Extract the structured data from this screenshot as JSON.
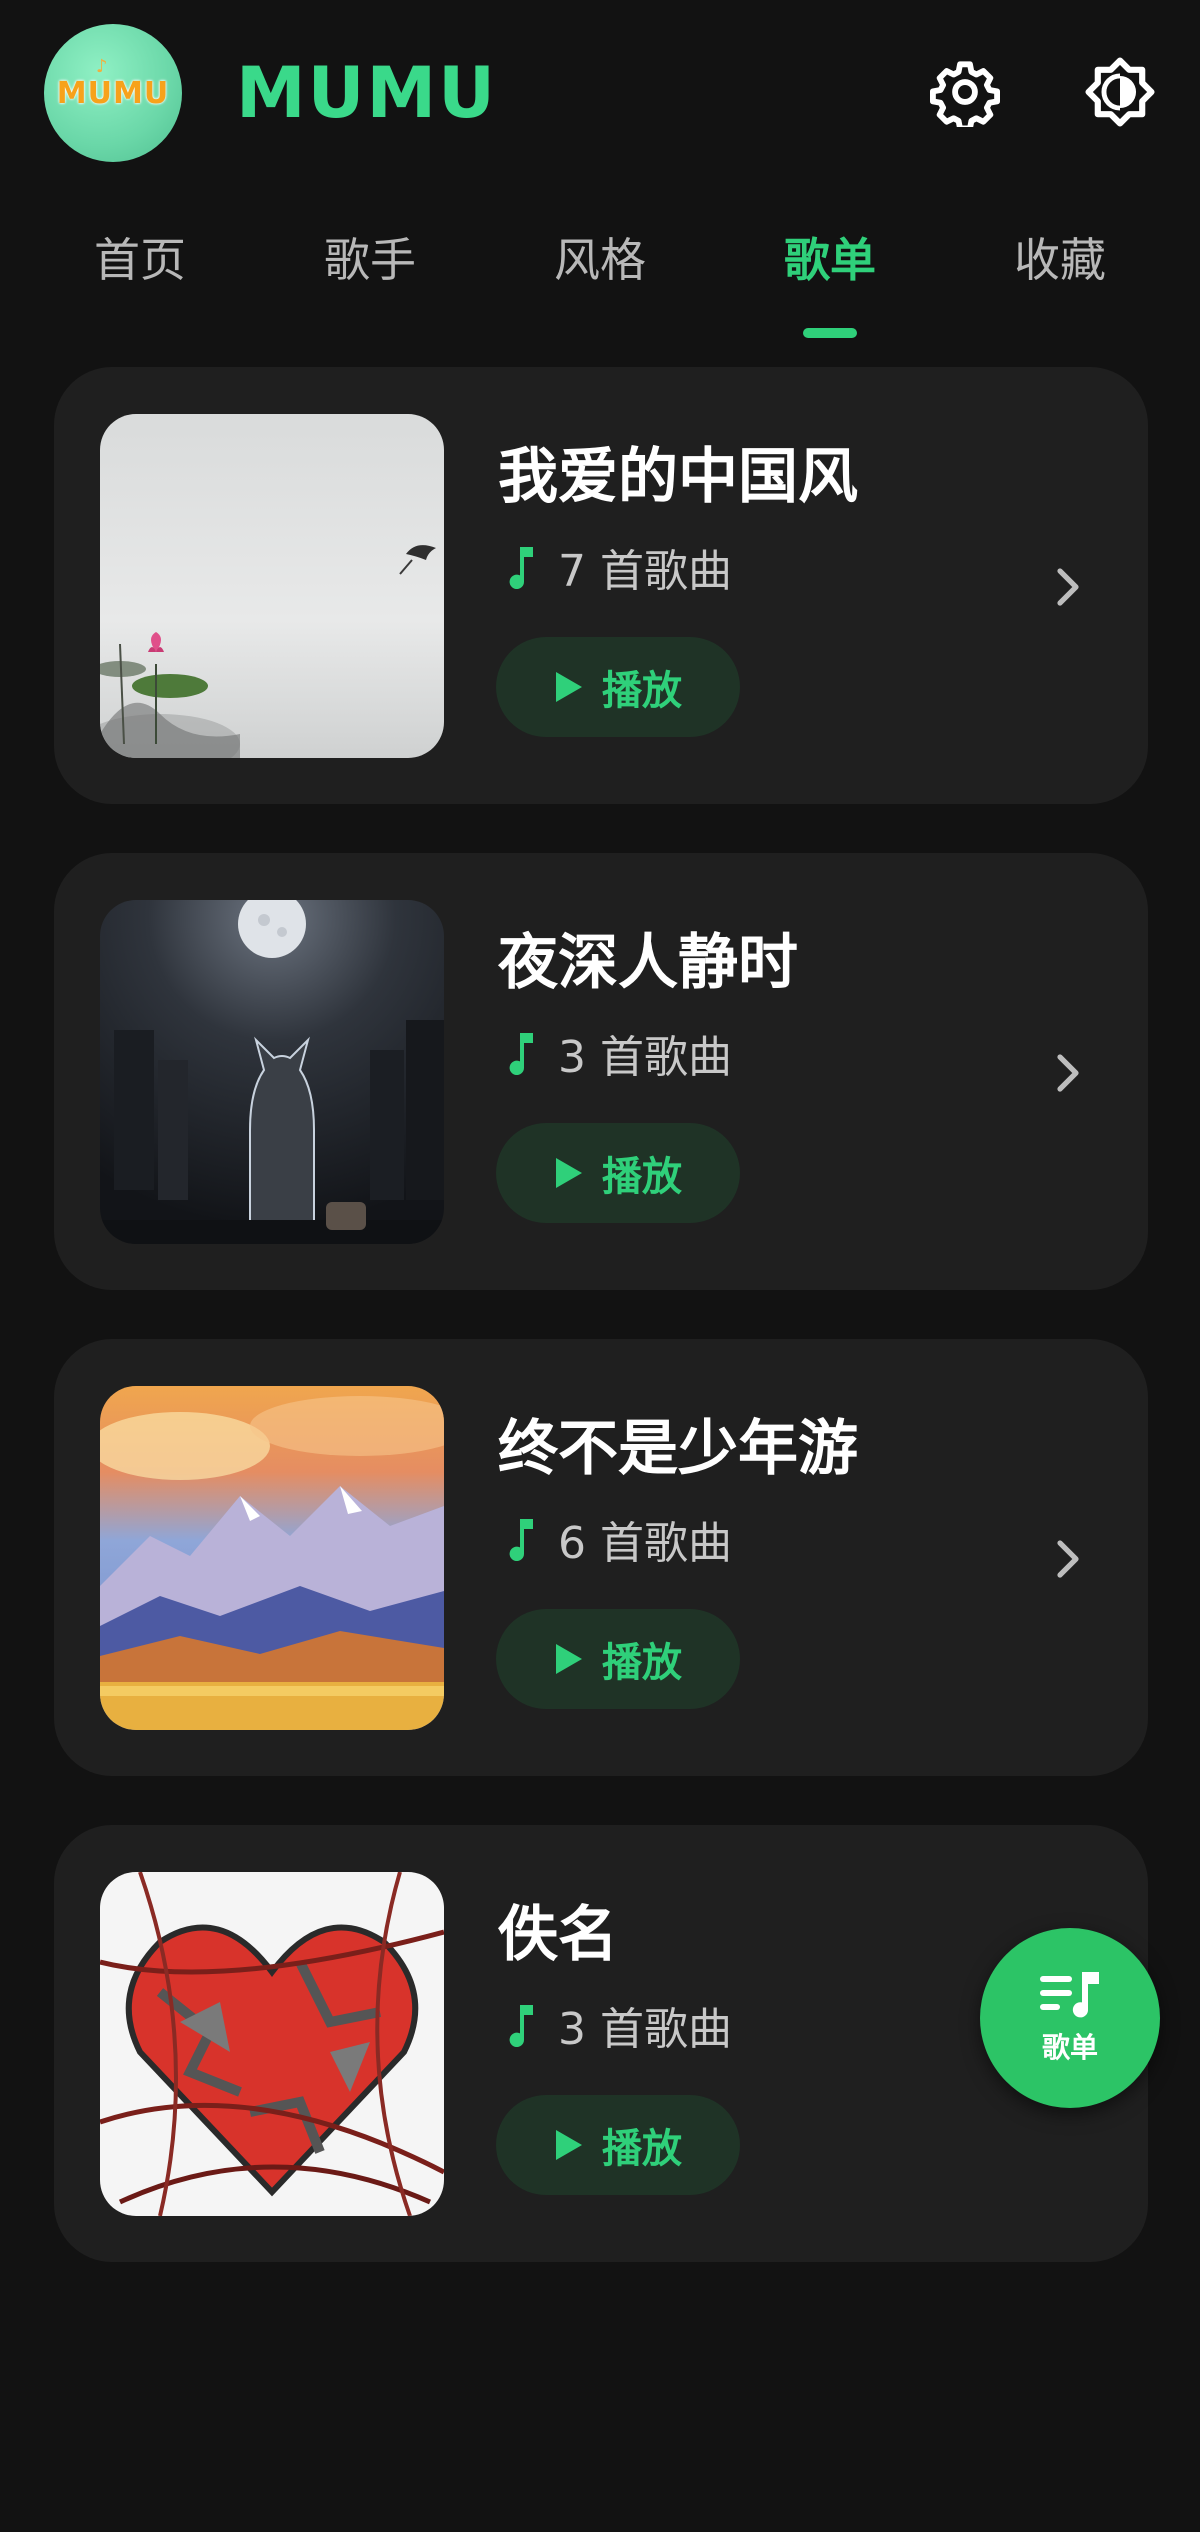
{
  "header": {
    "logo_text": "MUMU",
    "title": "MUMU",
    "settings_icon": "gear-icon",
    "theme_icon": "brightness-icon"
  },
  "tabs": [
    {
      "label": "首页",
      "active": false
    },
    {
      "label": "歌手",
      "active": false
    },
    {
      "label": "风格",
      "active": false
    },
    {
      "label": "歌单",
      "active": true
    },
    {
      "label": "收藏",
      "active": false
    }
  ],
  "playlists": [
    {
      "title": "我爱的中国风",
      "count": "7 首歌曲",
      "play_label": "播放",
      "cover": "ink-lotus-painting",
      "has_chevron": true
    },
    {
      "title": "夜深人静时",
      "count": "3 首歌曲",
      "play_label": "播放",
      "cover": "cat-under-moon",
      "has_chevron": true
    },
    {
      "title": "终不是少年游",
      "count": "6 首歌曲",
      "play_label": "播放",
      "cover": "mountain-sunset-lake",
      "has_chevron": true
    },
    {
      "title": "佚名",
      "count": "3 首歌曲",
      "play_label": "播放",
      "cover": "broken-heart-thorns",
      "has_chevron": false
    }
  ],
  "fab": {
    "label": "歌单",
    "icon": "playlist-icon"
  },
  "colors": {
    "accent": "#2fd07a",
    "title_green": "#3ad98a",
    "background": "#121212",
    "card": "#1f1f1f"
  }
}
